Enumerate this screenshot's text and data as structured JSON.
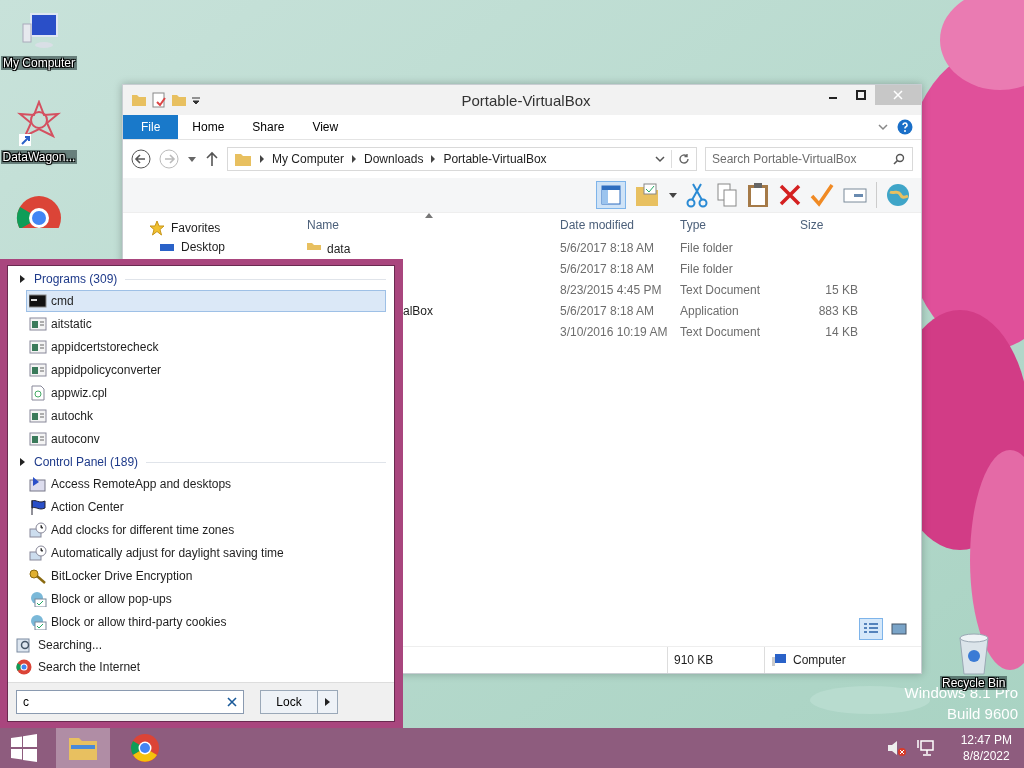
{
  "desktop_icons": [
    {
      "kind": "computer",
      "label": "My Computer"
    },
    {
      "kind": "shortcut",
      "label": "DataWagon..."
    },
    {
      "kind": "chrome"
    }
  ],
  "recycle_bin": {
    "label": "Recycle Bin"
  },
  "watermark": [
    "Windows 8.1 Pro",
    "Build 9600"
  ],
  "explorer": {
    "title": "Portable-VirtualBox",
    "ribbon_tabs": [
      {
        "label": "File",
        "kind": "file"
      },
      {
        "label": "Home",
        "kind": "tab"
      },
      {
        "label": "Share",
        "kind": "tab"
      },
      {
        "label": "View",
        "kind": "tab"
      }
    ],
    "address": [
      "My Computer",
      "Downloads",
      "Portable-VirtualBox"
    ],
    "search": {
      "placeholder": "Search Portable-VirtualBox"
    },
    "nav": [
      {
        "label": "Favorites",
        "kind": "header"
      },
      {
        "label": "Desktop",
        "kind": "item"
      }
    ],
    "columns": [
      "Name",
      "Date modified",
      "Type",
      "Size"
    ],
    "rows": [
      {
        "kind": "folder",
        "name": "data",
        "date": "5/6/2017 8:18 AM",
        "type": "File folder"
      },
      {
        "date": "5/6/2017 8:18 AM",
        "type": "File folder"
      },
      {
        "date": "8/23/2015 4:45 PM",
        "type": "Text Document",
        "size": "15 KB"
      },
      {
        "kind": "app",
        "name": "alBox",
        "date": "5/6/2017 8:18 AM",
        "type": "Application",
        "size": "883 KB"
      },
      {
        "date": "3/10/2016 10:19 AM",
        "type": "Text Document",
        "size": "14 KB"
      }
    ],
    "views": [
      {
        "kind": "details",
        "selected": true
      },
      {
        "kind": "large",
        "selected": false
      }
    ],
    "status": {
      "size": "910 KB",
      "location": "Computer"
    }
  },
  "start_menu": {
    "groups": [
      {
        "title": "Programs (309)",
        "items": [
          {
            "label": "cmd",
            "kind": "console",
            "selected": true
          },
          {
            "label": "aitstatic",
            "kind": "exe",
            "selected": false
          },
          {
            "label": "appidcertstorecheck",
            "kind": "exe",
            "selected": false
          },
          {
            "label": "appidpolicyconverter",
            "kind": "exe",
            "selected": false
          },
          {
            "label": "appwiz.cpl",
            "kind": "cpl",
            "selected": false
          },
          {
            "label": "autochk",
            "kind": "exe",
            "selected": false
          },
          {
            "label": "autoconv",
            "kind": "exe",
            "selected": false
          }
        ]
      },
      {
        "title": "Control Panel (189)",
        "items": [
          {
            "label": "Access RemoteApp and desktops",
            "kind": "remote",
            "selected": false
          },
          {
            "label": "Action Center",
            "kind": "flag",
            "selected": false
          },
          {
            "label": "Add clocks for different time zones",
            "kind": "clock",
            "selected": false
          },
          {
            "label": "Automatically adjust for daylight saving time",
            "kind": "clock",
            "selected": false
          },
          {
            "label": "BitLocker Drive Encryption",
            "kind": "keys",
            "selected": false
          },
          {
            "label": "Block or allow pop-ups",
            "kind": "globe",
            "selected": false
          },
          {
            "label": "Block or allow third-party cookies",
            "kind": "globe",
            "selected": false
          }
        ]
      }
    ],
    "footer": [
      {
        "label": "Searching...",
        "kind": "searching"
      },
      {
        "label": "Search the Internet",
        "kind": "chrome"
      }
    ],
    "search": {
      "value": "c"
    },
    "power_button": "Lock"
  },
  "taskbar": {
    "buttons": [
      {
        "kind": "start",
        "selected": false
      },
      {
        "kind": "explorer",
        "selected": true
      },
      {
        "kind": "chrome",
        "selected": false
      }
    ],
    "time": "12:47 PM",
    "date": "8/8/2022"
  }
}
